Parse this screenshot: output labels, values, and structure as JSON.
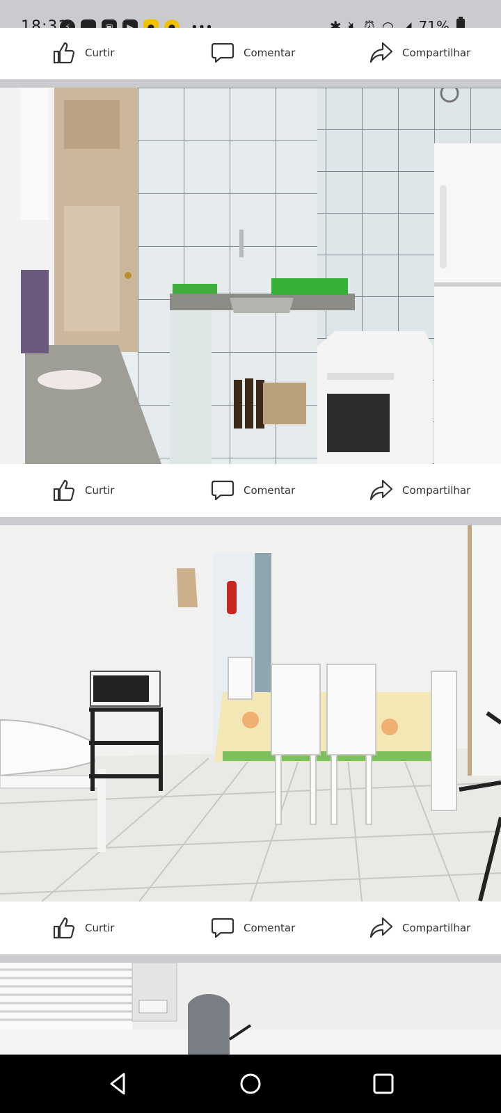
{
  "status": {
    "time": "18:31",
    "battery": "71%",
    "icons_left": [
      "messenger-icon",
      "bag-icon",
      "gallery-icon",
      "youtube-icon",
      "coin-icon",
      "coin-icon"
    ],
    "icons_right": [
      "bluetooth-icon",
      "mute-icon",
      "alarm-icon",
      "wifi-icon",
      "signal-icon",
      "battery-icon"
    ]
  },
  "actions": {
    "like": "Curtir",
    "comment": "Comentar",
    "share": "Compartilhar"
  },
  "posts": [
    {
      "photo_subject": "kitchen"
    },
    {
      "photo_subject": "dining-room"
    },
    {
      "photo_subject": "living-room"
    }
  ],
  "colors": {
    "background": "#c9cbcf",
    "card": "#ffffff",
    "icon": "#333333",
    "navbar": "#000000"
  }
}
